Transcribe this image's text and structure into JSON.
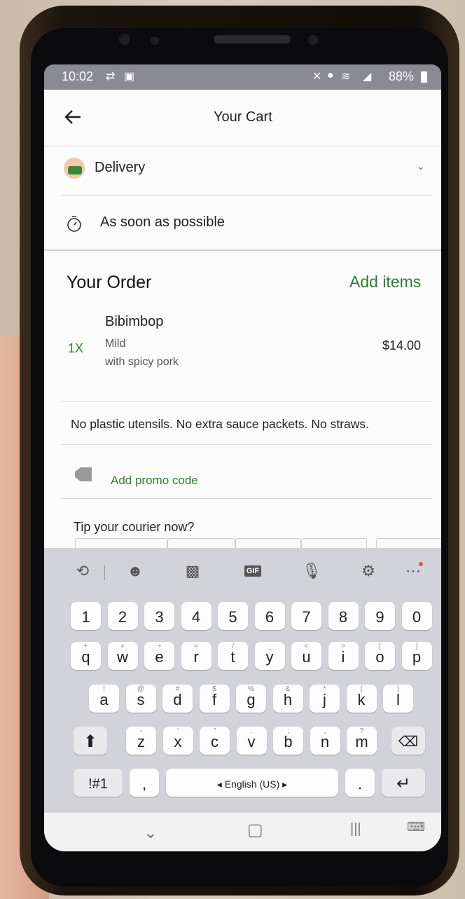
{
  "status": {
    "time": "10:02",
    "battery": "88%"
  },
  "header": {
    "title": "Your Cart"
  },
  "delivery": {
    "label": "Delivery"
  },
  "schedule": {
    "label": "As soon as possible"
  },
  "order": {
    "heading": "Your Order",
    "add_items": "Add items",
    "items": [
      {
        "qty": "1X",
        "name": "Bibimbop",
        "options": [
          "Mild",
          "with spicy pork"
        ],
        "price": "$14.00"
      }
    ]
  },
  "notes": "No plastic utensils. No extra sauce packets. No straws.",
  "promo": {
    "label": "Add promo code"
  },
  "tip": {
    "label": "Tip your courier now?"
  },
  "keyboard": {
    "numbers": [
      "1",
      "2",
      "3",
      "4",
      "5",
      "6",
      "7",
      "8",
      "9",
      "0"
    ],
    "row1": {
      "keys": [
        "q",
        "w",
        "e",
        "r",
        "t",
        "y",
        "u",
        "i",
        "o",
        "p"
      ],
      "subs": [
        "+",
        "×",
        "÷",
        "=",
        "/",
        "_",
        "<",
        ">",
        "[",
        "]"
      ]
    },
    "row2": {
      "keys": [
        "a",
        "s",
        "d",
        "f",
        "g",
        "h",
        "j",
        "k",
        "l"
      ],
      "subs": [
        "!",
        "@",
        "#",
        "$",
        "%",
        "&",
        "*",
        "(",
        ")"
      ]
    },
    "row3": {
      "keys": [
        "z",
        "x",
        "c",
        "v",
        "b",
        "n",
        "m"
      ],
      "subs": [
        "-",
        "'",
        "\"",
        ":",
        ";",
        ",",
        "?"
      ]
    },
    "symbols": "!#1",
    "comma": ",",
    "space": "English (US)",
    "period": "."
  }
}
